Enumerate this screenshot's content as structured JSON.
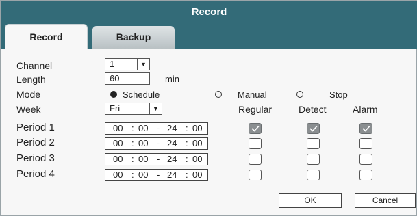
{
  "window": {
    "title": "Record"
  },
  "tabs": [
    {
      "label": "Record",
      "active": true
    },
    {
      "label": "Backup",
      "active": false
    }
  ],
  "fields": {
    "channel": {
      "label": "Channel",
      "value": "1"
    },
    "length": {
      "label": "Length",
      "value": "60",
      "unit": "min"
    },
    "mode": {
      "label": "Mode",
      "options": [
        {
          "label": "Schedule",
          "selected": true
        },
        {
          "label": "Manual",
          "selected": false
        },
        {
          "label": "Stop",
          "selected": false
        }
      ]
    },
    "week": {
      "label": "Week",
      "value": "Fri"
    }
  },
  "columns": [
    "Regular",
    "Detect",
    "Alarm"
  ],
  "periods": [
    {
      "label": "Period 1",
      "start_h": "00",
      "start_m": "00",
      "end_h": "24",
      "end_m": "00",
      "regular": true,
      "detect": true,
      "alarm": true
    },
    {
      "label": "Period 2",
      "start_h": "00",
      "start_m": "00",
      "end_h": "24",
      "end_m": "00",
      "regular": false,
      "detect": false,
      "alarm": false
    },
    {
      "label": "Period 3",
      "start_h": "00",
      "start_m": "00",
      "end_h": "24",
      "end_m": "00",
      "regular": false,
      "detect": false,
      "alarm": false
    },
    {
      "label": "Period 4",
      "start_h": "00",
      "start_m": "00",
      "end_h": "24",
      "end_m": "00",
      "regular": false,
      "detect": false,
      "alarm": false
    }
  ],
  "time_separators": {
    "colon": ":",
    "dash": "-"
  },
  "buttons": {
    "ok": "OK",
    "cancel": "Cancel"
  },
  "colors": {
    "title_bar": "#336b78",
    "checked": "#8a8e90"
  }
}
